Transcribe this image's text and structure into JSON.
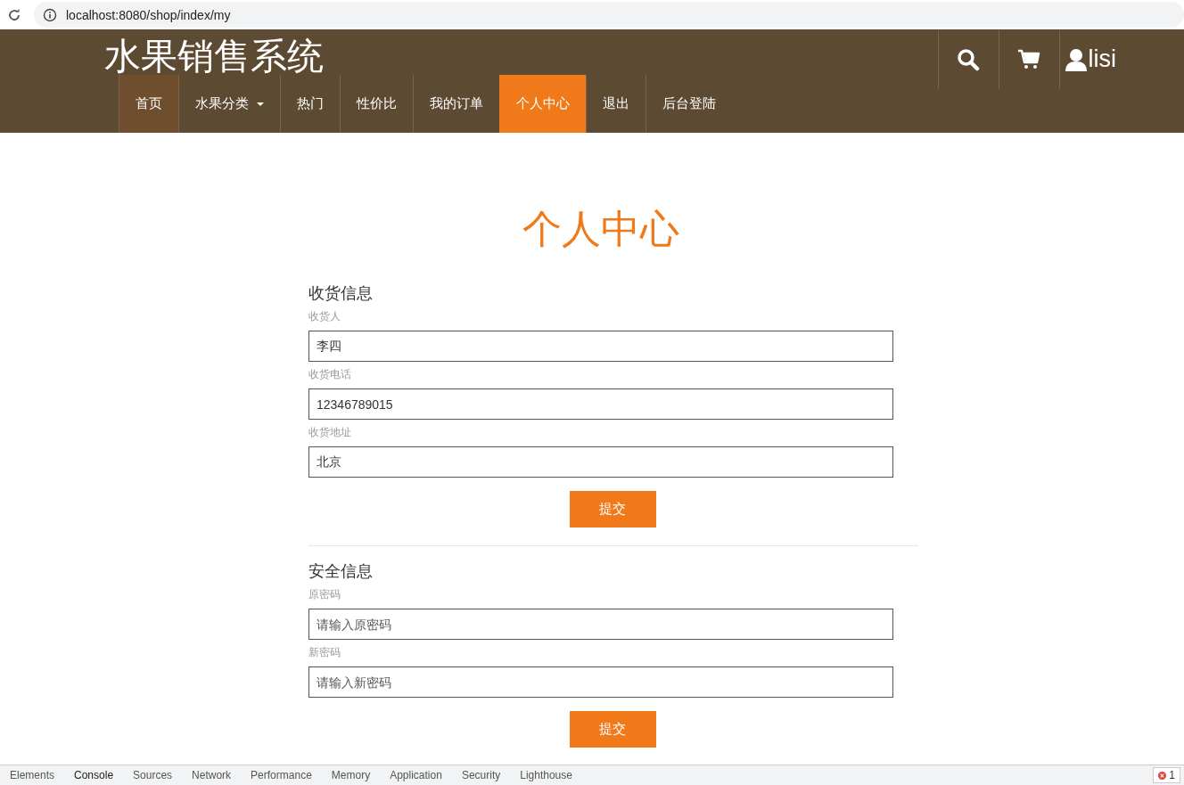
{
  "browser": {
    "url": "localhost:8080/shop/index/my"
  },
  "header": {
    "title": "水果销售系统",
    "user": "lisi",
    "nav": [
      {
        "label": "首页",
        "selected": false,
        "highlighted": true,
        "dropdown": false
      },
      {
        "label": "水果分类",
        "selected": false,
        "highlighted": false,
        "dropdown": true
      },
      {
        "label": "热门",
        "selected": false,
        "highlighted": false,
        "dropdown": false
      },
      {
        "label": "性价比",
        "selected": false,
        "highlighted": false,
        "dropdown": false
      },
      {
        "label": "我的订单",
        "selected": false,
        "highlighted": false,
        "dropdown": false
      },
      {
        "label": "个人中心",
        "selected": true,
        "highlighted": false,
        "dropdown": false
      },
      {
        "label": "退出",
        "selected": false,
        "highlighted": false,
        "dropdown": false
      },
      {
        "label": "后台登陆",
        "selected": false,
        "highlighted": false,
        "dropdown": false
      }
    ]
  },
  "page_title": "个人中心",
  "sections": [
    {
      "heading": "收货信息",
      "fields": [
        {
          "label": "收货人",
          "value": "李四"
        },
        {
          "label": "收货电话",
          "value": "12346789015"
        },
        {
          "label": "收货地址",
          "value": "北京"
        }
      ],
      "button": "提交"
    },
    {
      "heading": "安全信息",
      "fields": [
        {
          "label": "原密码",
          "placeholder": "请输入原密码"
        },
        {
          "label": "新密码",
          "placeholder": "请输入新密码"
        }
      ],
      "button": "提交"
    }
  ],
  "devtools": {
    "tabs": [
      {
        "label": "Elements",
        "selected": false
      },
      {
        "label": "Console",
        "selected": true
      },
      {
        "label": "Sources",
        "selected": false
      },
      {
        "label": "Network",
        "selected": false
      },
      {
        "label": "Performance",
        "selected": false
      },
      {
        "label": "Memory",
        "selected": false
      },
      {
        "label": "Application",
        "selected": false
      },
      {
        "label": "Security",
        "selected": false
      },
      {
        "label": "Lighthouse",
        "selected": false
      }
    ],
    "error_count": "1"
  }
}
